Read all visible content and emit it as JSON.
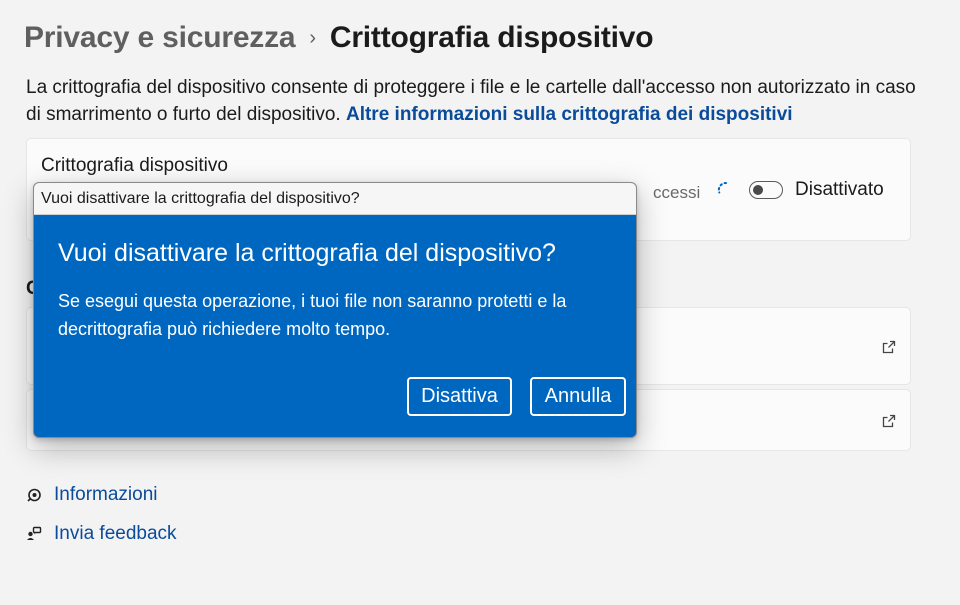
{
  "breadcrumb": {
    "parent": "Privacy e sicurezza",
    "separator": "›",
    "current": "Crittografia dispositivo"
  },
  "description": {
    "text": "La crittografia del dispositivo consente di proteggere i file e le cartelle dall'accesso non autorizzato in caso di smarrimento o furto del dispositivo. ",
    "link": "Altre informazioni sulla crittografia dei dispositivi"
  },
  "encryption_card": {
    "title": "Crittografia dispositivo",
    "subtitle_partial": "ccessi",
    "toggle_state": "Disattivato",
    "toggle_on": false
  },
  "section": {
    "heading_partial": "C"
  },
  "footer": {
    "info_label": "Informazioni",
    "feedback_label": "Invia feedback"
  },
  "dialog": {
    "window_title": "Vuoi disattivare la crittografia del dispositivo?",
    "heading": "Vuoi disattivare la crittografia del dispositivo?",
    "body": "Se esegui questa operazione, i tuoi file non saranno protetti e la decrittografia può richiedere molto tempo.",
    "confirm_label": "Disattiva",
    "cancel_label": "Annulla",
    "accent_color": "#0067c0"
  },
  "colors": {
    "link": "#0a4b9a",
    "background": "#f3f3f3",
    "card": "#fbfbfb"
  },
  "icons": {
    "separator": "chevron-right-icon",
    "spinner": "loading-spinner-icon",
    "external": "external-link-icon",
    "info": "info-help-icon",
    "feedback": "feedback-icon"
  }
}
